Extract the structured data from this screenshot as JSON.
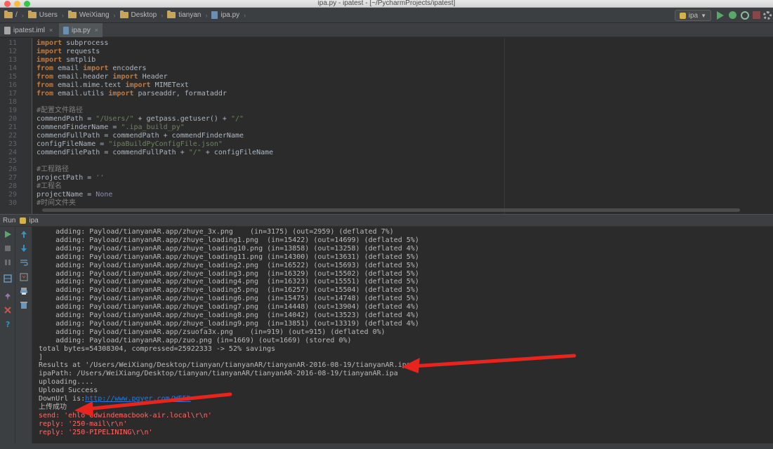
{
  "window": {
    "title": "ipa.py - ipatest - [~/PycharmProjects/ipatest]"
  },
  "navbar": {
    "crumbs": [
      "/",
      "Users",
      "WeiXiang",
      "Desktop",
      "tianyan",
      "ipa.py"
    ],
    "run_config": "ipa"
  },
  "tabs": [
    {
      "label": "ipatest.iml",
      "close": "×"
    },
    {
      "label": "ipa.py",
      "close": "×"
    }
  ],
  "editor": {
    "lines": [
      {
        "n": "11",
        "parts": [
          [
            "kw",
            "import"
          ],
          [
            "",
            "subprocess"
          ]
        ]
      },
      {
        "n": "12",
        "parts": [
          [
            "kw",
            "import"
          ],
          [
            "",
            "requests"
          ]
        ]
      },
      {
        "n": "13",
        "parts": [
          [
            "kw",
            "import"
          ],
          [
            "",
            "smtplib"
          ]
        ]
      },
      {
        "n": "14",
        "parts": [
          [
            "kw",
            "from"
          ],
          [
            "",
            "email "
          ],
          [
            "kw",
            "import"
          ],
          [
            "",
            "encoders"
          ]
        ]
      },
      {
        "n": "15",
        "parts": [
          [
            "kw",
            "from"
          ],
          [
            "",
            "email.header "
          ],
          [
            "kw",
            "import"
          ],
          [
            "",
            "Header"
          ]
        ]
      },
      {
        "n": "16",
        "parts": [
          [
            "kw",
            "from"
          ],
          [
            "",
            "email.mime.text "
          ],
          [
            "kw",
            "import"
          ],
          [
            "",
            "MIMEText"
          ]
        ]
      },
      {
        "n": "17",
        "parts": [
          [
            "kw",
            "from"
          ],
          [
            "",
            "email.utils "
          ],
          [
            "kw",
            "import"
          ],
          [
            "",
            "parseaddr, formataddr"
          ]
        ]
      },
      {
        "n": "18",
        "parts": []
      },
      {
        "n": "19",
        "parts": [
          [
            "cmt",
            "#配置文件路径"
          ]
        ]
      },
      {
        "n": "20",
        "parts": [
          [
            "",
            "commendPath = "
          ],
          [
            "str",
            "\"/Users/\""
          ],
          [
            "",
            " + getpass.getuser() + "
          ],
          [
            "str",
            "\"/\""
          ]
        ]
      },
      {
        "n": "21",
        "parts": [
          [
            "",
            "commendFinderName = "
          ],
          [
            "str",
            "\".ipa_build_py\""
          ]
        ]
      },
      {
        "n": "22",
        "parts": [
          [
            "",
            "commendFullPath = commendPath + commendFinderName"
          ]
        ]
      },
      {
        "n": "23",
        "parts": [
          [
            "",
            "configFileName = "
          ],
          [
            "str",
            "\"ipaBuildPyConfigFile.json\""
          ]
        ]
      },
      {
        "n": "24",
        "parts": [
          [
            "",
            "commendFilePath = commendFullPath + "
          ],
          [
            "str",
            "\"/\""
          ],
          [
            "",
            " + configFileName"
          ]
        ]
      },
      {
        "n": "25",
        "parts": []
      },
      {
        "n": "26",
        "parts": [
          [
            "cmt",
            "#工程路径"
          ]
        ]
      },
      {
        "n": "27",
        "parts": [
          [
            "",
            "projectPath = "
          ],
          [
            "str",
            "''"
          ]
        ]
      },
      {
        "n": "28",
        "parts": [
          [
            "cmt",
            "#工程名"
          ]
        ]
      },
      {
        "n": "29",
        "parts": [
          [
            "",
            "projectName = "
          ],
          [
            "none",
            "None"
          ]
        ]
      },
      {
        "n": "30",
        "parts": [
          [
            "cmt",
            "#时间文件夹"
          ]
        ]
      }
    ]
  },
  "run_panel": {
    "label": "Run",
    "config": "ipa"
  },
  "console": {
    "lines": [
      {
        "text": "    adding: Payload/tianyanAR.app/zhuye_3x.png    (in=3175) (out=2959) (deflated 7%)",
        "style": ""
      },
      {
        "text": "    adding: Payload/tianyanAR.app/zhuye_loading1.png  (in=15422) (out=14699) (deflated 5%)",
        "style": ""
      },
      {
        "text": "    adding: Payload/tianyanAR.app/zhuye_loading10.png (in=13858) (out=13258) (deflated 4%)",
        "style": ""
      },
      {
        "text": "    adding: Payload/tianyanAR.app/zhuye_loading11.png (in=14300) (out=13631) (deflated 5%)",
        "style": ""
      },
      {
        "text": "    adding: Payload/tianyanAR.app/zhuye_loading2.png  (in=16522) (out=15693) (deflated 5%)",
        "style": ""
      },
      {
        "text": "    adding: Payload/tianyanAR.app/zhuye_loading3.png  (in=16329) (out=15502) (deflated 5%)",
        "style": ""
      },
      {
        "text": "    adding: Payload/tianyanAR.app/zhuye_loading4.png  (in=16323) (out=15551) (deflated 5%)",
        "style": ""
      },
      {
        "text": "    adding: Payload/tianyanAR.app/zhuye_loading5.png  (in=16257) (out=15504) (deflated 5%)",
        "style": ""
      },
      {
        "text": "    adding: Payload/tianyanAR.app/zhuye_loading6.png  (in=15475) (out=14748) (deflated 5%)",
        "style": ""
      },
      {
        "text": "    adding: Payload/tianyanAR.app/zhuye_loading7.png  (in=14448) (out=13904) (deflated 4%)",
        "style": ""
      },
      {
        "text": "    adding: Payload/tianyanAR.app/zhuye_loading8.png  (in=14042) (out=13523) (deflated 4%)",
        "style": ""
      },
      {
        "text": "    adding: Payload/tianyanAR.app/zhuye_loading9.png  (in=13851) (out=13319) (deflated 4%)",
        "style": ""
      },
      {
        "text": "    adding: Payload/tianyanAR.app/zsuofa3x.png    (in=919) (out=915) (deflated 0%)",
        "style": ""
      },
      {
        "text": "    adding: Payload/tianyanAR.app/zuo.png (in=1669) (out=1669) (stored 0%)",
        "style": ""
      },
      {
        "text": "total bytes=54308304, compressed=25922333 -> 52% savings",
        "style": ""
      },
      {
        "text": "]",
        "style": ""
      },
      {
        "text": "Results at '/Users/WeiXiang/Desktop/tianyan/tianyanAR/tianyanAR-2016-08-19/tianyanAR.ipa'",
        "style": ""
      },
      {
        "text": "ipaPath: /Users/WeiXiang/Desktop/tianyan/tianyanAR/tianyanAR-2016-08-19/tianyanAR.ipa",
        "style": ""
      },
      {
        "text": "uploading....",
        "style": ""
      },
      {
        "text": "Upload Success",
        "style": ""
      },
      {
        "text": "DownUrl is:",
        "style": "",
        "link": "http://www.pgyer.com/WE5D"
      },
      {
        "text": "上传成功",
        "style": ""
      },
      {
        "text": "send: 'ehlo edwindemacbook-air.local\\r\\n'",
        "style": "red"
      },
      {
        "text": "reply: '250-mail\\r\\n'",
        "style": "red"
      },
      {
        "text": "reply: '250-PIPELINING\\r\\n'",
        "style": "red"
      }
    ]
  },
  "colors": {
    "annotation_arrow": "#e8241c",
    "keyword": "#cc7832",
    "string": "#6a8759",
    "comment": "#808080",
    "stderr": "#ff6b68",
    "link": "#287bde"
  }
}
